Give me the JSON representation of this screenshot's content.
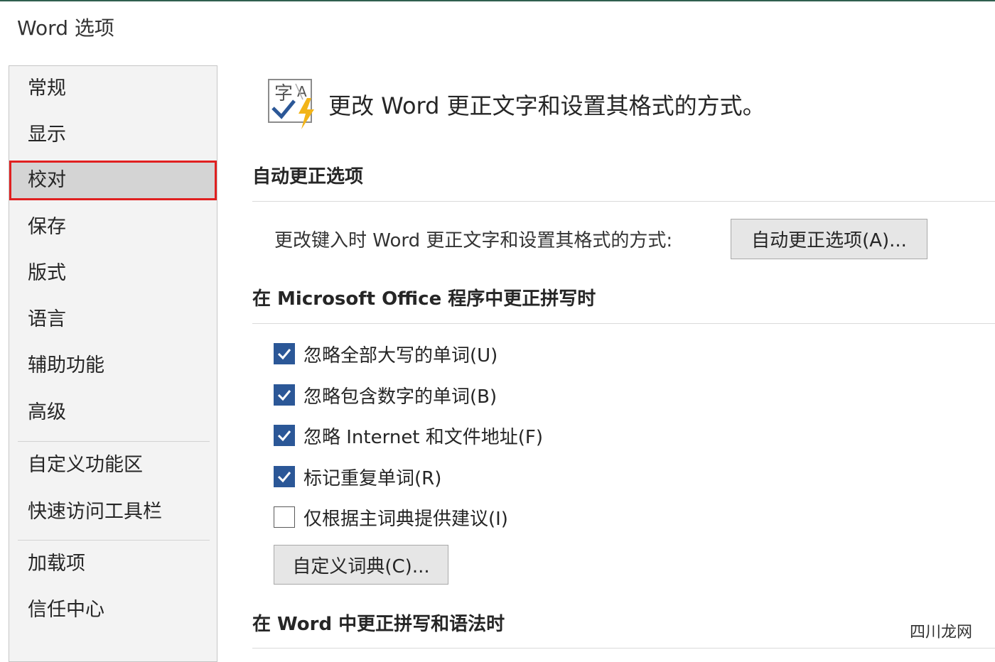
{
  "window": {
    "title": "Word 选项"
  },
  "nav": {
    "items": [
      {
        "label": "常规"
      },
      {
        "label": "显示"
      },
      {
        "label": "校对"
      },
      {
        "label": "保存"
      },
      {
        "label": "版式"
      },
      {
        "label": "语言"
      },
      {
        "label": "辅助功能"
      },
      {
        "label": "高级"
      },
      {
        "label": "自定义功能区"
      },
      {
        "label": "快速访问工具栏"
      },
      {
        "label": "加载项"
      },
      {
        "label": "信任中心"
      }
    ],
    "selected": "校对"
  },
  "main": {
    "header": {
      "text": "更改 Word 更正文字和设置其格式的方式。",
      "icon": "proofing-icon"
    },
    "autocorrect_section": {
      "title": "自动更正选项",
      "description": "更改键入时 Word 更正文字和设置其格式的方式:",
      "button_label": "自动更正选项(A)..."
    },
    "office_section": {
      "title": "在 Microsoft Office 程序中更正拼写时",
      "checkboxes": [
        {
          "label": "忽略全部大写的单词(U)",
          "checked": true
        },
        {
          "label": "忽略包含数字的单词(B)",
          "checked": true
        },
        {
          "label": "忽略 Internet 和文件地址(F)",
          "checked": true
        },
        {
          "label": "标记重复单词(R)",
          "checked": true
        },
        {
          "label": "仅根据主词典提供建议(I)",
          "checked": false
        }
      ],
      "custom_dict_button": "自定义词典(C)..."
    },
    "word_section": {
      "title": "在 Word 中更正拼写和语法时"
    }
  },
  "watermark": "四川龙网",
  "colors": {
    "accent_check": "#2b5797",
    "selection_border": "#e02020",
    "top_line": "#2f5f4e"
  }
}
